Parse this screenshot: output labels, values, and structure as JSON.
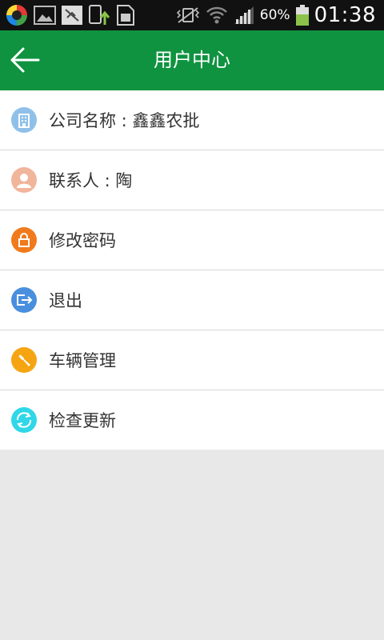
{
  "status_bar": {
    "battery_percent": "60%",
    "time": "01:38",
    "left_icons": [
      "app-logo-icon",
      "gallery-icon",
      "muted-usb-icon",
      "phone-upload-icon",
      "sim-card-icon"
    ],
    "right_icons": [
      "vibrate-icon",
      "wifi-icon",
      "signal-icon",
      "battery-icon"
    ]
  },
  "header": {
    "title": "用户中心",
    "back_icon": "back-arrow-icon",
    "background": "#0f9340"
  },
  "menu": {
    "items": [
      {
        "label": "公司名称 : 鑫鑫农批",
        "icon": "building-icon",
        "color": "#8fc0ea"
      },
      {
        "label": "联系人 : 陶",
        "icon": "person-icon",
        "color": "#f0b59a"
      },
      {
        "label": "修改密码",
        "icon": "lock-icon",
        "color": "#f07a1c"
      },
      {
        "label": "退出",
        "icon": "logout-icon",
        "color": "#4a8fdd"
      },
      {
        "label": "车辆管理",
        "icon": "wrench-icon",
        "color": "#f5a511"
      },
      {
        "label": "检查更新",
        "icon": "refresh-icon",
        "color": "#2fd7e8"
      }
    ]
  }
}
